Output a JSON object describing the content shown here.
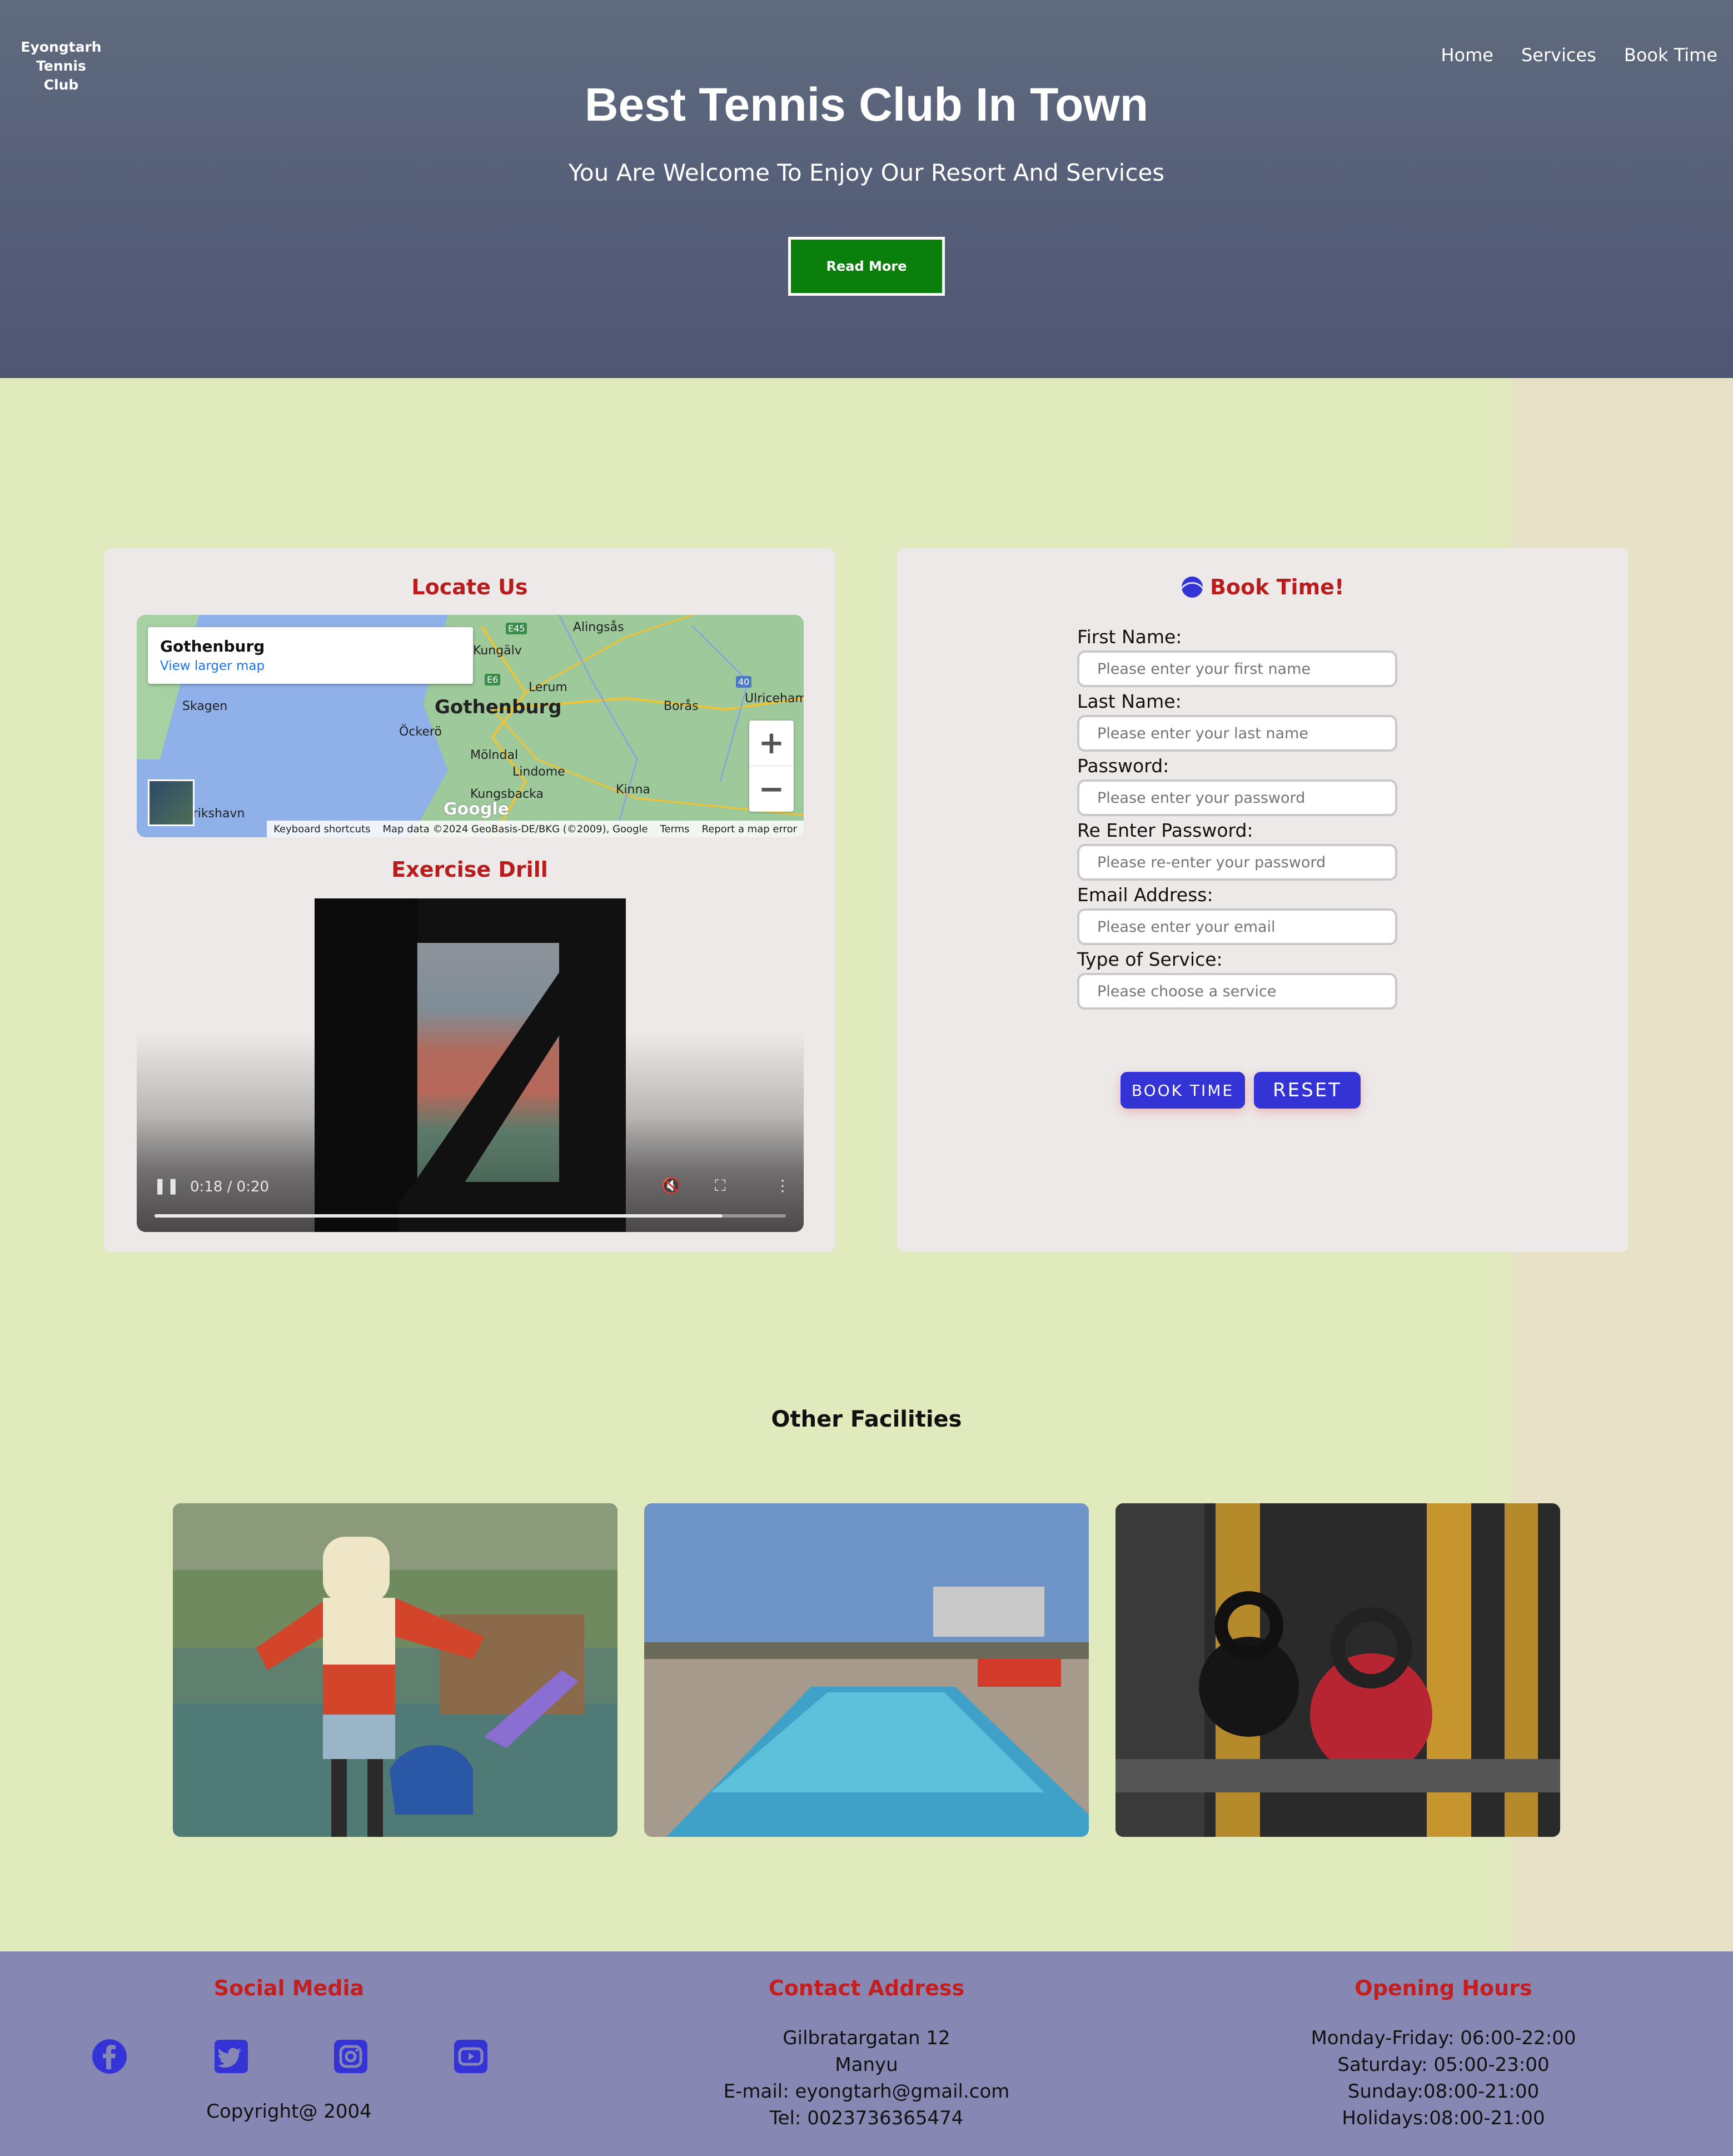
{
  "brand": {
    "line1": "Eyongtarh",
    "line2": "Tennis Club"
  },
  "nav": {
    "home": "Home",
    "services": "Services",
    "book": "Book Time"
  },
  "hero": {
    "title": "Best Tennis Club In Town",
    "subtitle": "You Are Welcome To Enjoy Our Resort And Services",
    "button": "Read More"
  },
  "locate": {
    "title": "Locate Us",
    "map": {
      "place": "Gothenburg",
      "larger_link": "View larger map",
      "labels": [
        "Alingsås",
        "Kungälv",
        "Lerum",
        "Skagen",
        "Gothenburg",
        "Borås",
        "Ulricehamn",
        "Öckerö",
        "Mölndal",
        "Lindome",
        "Kungsbacka",
        "Kinna",
        "Frederikshavn"
      ],
      "road_labels": [
        "E45",
        "E6",
        "40"
      ],
      "footer": [
        "Keyboard shortcuts",
        "Map data ©2024 GeoBasis-DE/BKG (©2009), Google",
        "Terms",
        "Report a map error"
      ],
      "logo": "Google",
      "zoom_in": "+",
      "zoom_out": "−"
    }
  },
  "drill": {
    "title": "Exercise Drill",
    "time": "0:18 / 0:20",
    "progress": 0.9
  },
  "booking": {
    "title": "Book Time!",
    "fields": [
      {
        "label": "First Name:",
        "placeholder": "Please enter your first name"
      },
      {
        "label": "Last Name:",
        "placeholder": "Please enter your last name"
      },
      {
        "label": "Password:",
        "placeholder": "Please enter your password"
      },
      {
        "label": "Re Enter Password:",
        "placeholder": "Please re-enter your password"
      },
      {
        "label": "Email Address:",
        "placeholder": "Please enter your email"
      },
      {
        "label": "Type of Service:",
        "placeholder": "Please choose a service"
      }
    ],
    "submit": "BOOK TIME",
    "reset": "RESET"
  },
  "facilities": {
    "title": "Other Facilities",
    "images": [
      "playground-photo",
      "pool-photo",
      "gym-photo"
    ]
  },
  "footer": {
    "social_title": "Social Media",
    "social_icons": [
      "facebook-icon",
      "twitter-icon",
      "instagram-icon",
      "youtube-icon"
    ],
    "copyright": "Copyright@ 2004",
    "contact_title": "Contact Address",
    "contact_lines": [
      "Gilbratargatan 12",
      "Manyu",
      "E-mail: eyongtarh@gmail.com",
      "Tel: 0023736365474"
    ],
    "hours_title": "Opening Hours",
    "hours_lines": [
      "Monday-Friday: 06:00-22:00",
      "Saturday: 05:00-23:00",
      "Sunday:08:00-21:00",
      "Holidays:08:00-21:00"
    ]
  },
  "colors": {
    "accent_red": "#c41e1e",
    "button_blue": "#3434d6",
    "hero_green": "#0b7f0b",
    "footer_bg": "#8787b3",
    "page_bg": "#e1eabc"
  }
}
